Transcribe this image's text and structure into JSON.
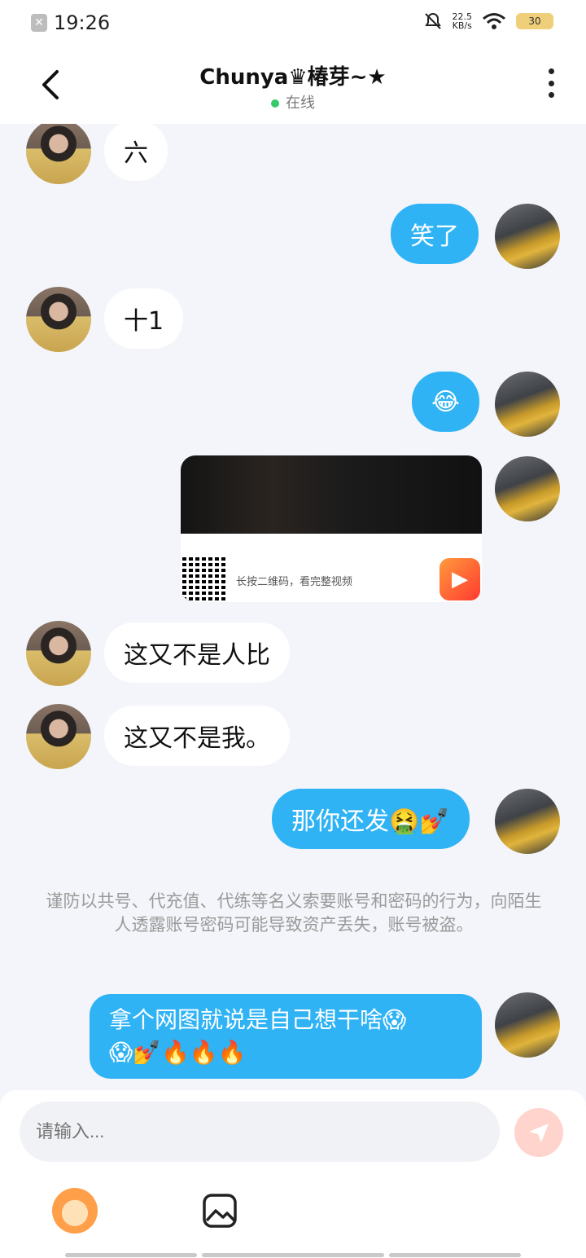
{
  "statusbar": {
    "time": "19:26",
    "speed_value": "22.5",
    "speed_unit": "KB/s",
    "battery": "30"
  },
  "header": {
    "title": "Chunya♛椿芽~★",
    "status": "在线"
  },
  "messages": [
    {
      "side": "in",
      "text": "六"
    },
    {
      "side": "out",
      "text": "笑了"
    },
    {
      "side": "in",
      "text": "十1"
    },
    {
      "side": "out",
      "text": "😂"
    },
    {
      "side": "out",
      "type": "video_card",
      "caption": "长按二维码，看完整视频"
    },
    {
      "side": "in",
      "text": "这又不是人比"
    },
    {
      "side": "in",
      "text": "这又不是我。"
    },
    {
      "side": "out",
      "text": "那你还发🤮💅"
    },
    {
      "side": "out",
      "text_line1": "拿个网图就说是自己想干啥😱",
      "text_line2": "😱💅🔥🔥🔥"
    }
  ],
  "notice": "谨防以共号、代充值、代练等名义索要账号和密码的行为，向陌生人透露账号密码可能导致资产丢失，账号被盗。",
  "input": {
    "placeholder": "请输入..."
  },
  "icons": [
    "back-arrow-icon",
    "more-vert-icon",
    "send-icon",
    "mascot-sticker-icon",
    "image-icon"
  ],
  "colors": {
    "outgoing_bubble": "#2fb3f5",
    "incoming_bubble": "#ffffff",
    "online_dot": "#39c96b",
    "send_button": "#ffd4cc"
  }
}
